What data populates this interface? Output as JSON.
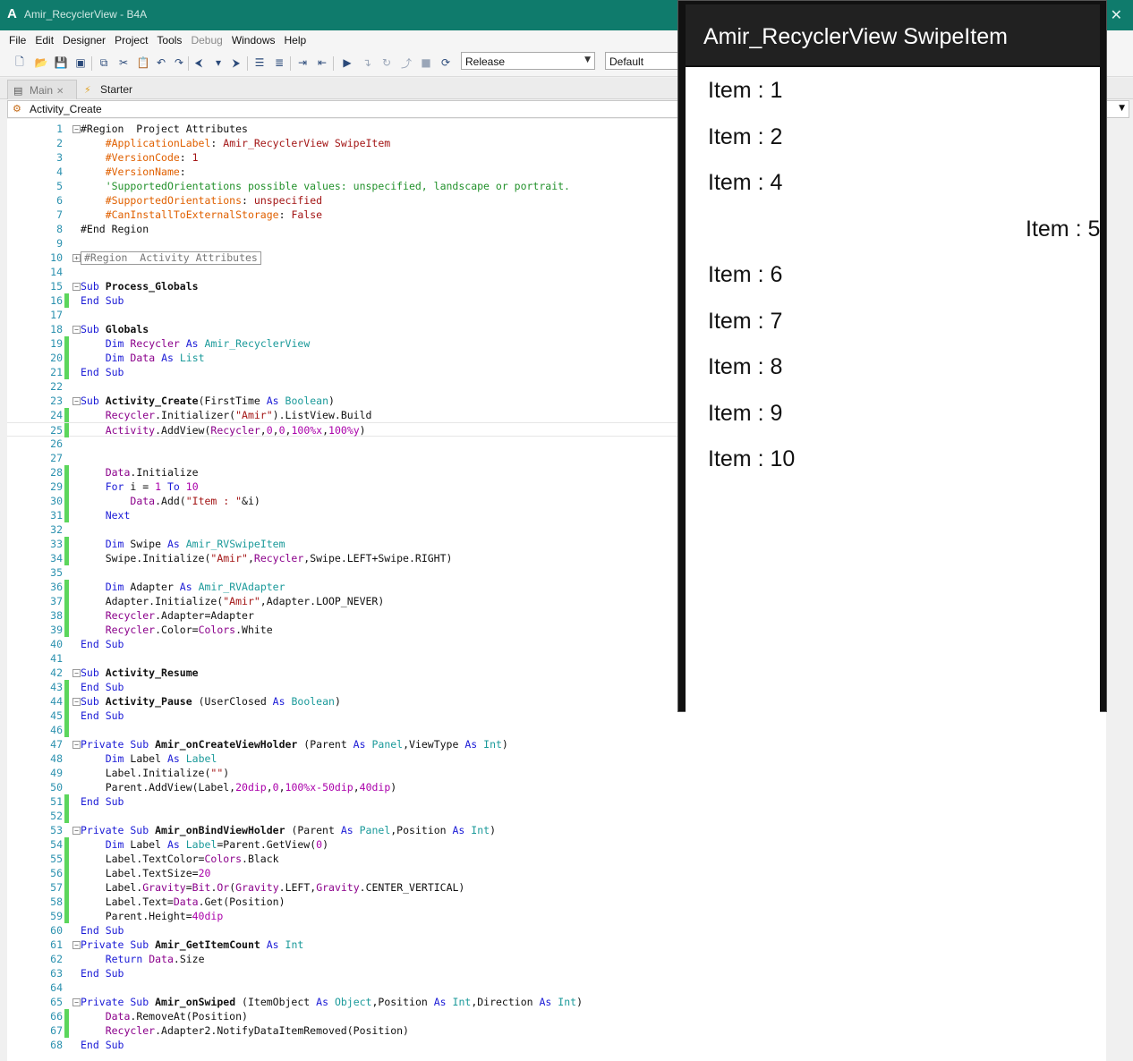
{
  "window": {
    "app_icon": "A",
    "title": "Amir_RecyclerView - B4A",
    "close_icon": "✕"
  },
  "menu": [
    "File",
    "Edit",
    "Designer",
    "Project",
    "Tools",
    "Debug",
    "Windows",
    "Help"
  ],
  "toolbar": {
    "build_config": "Release",
    "device_config": "Default"
  },
  "tabs": [
    {
      "label": "Main",
      "icon": "form-icon"
    },
    {
      "label": "Starter",
      "icon": "lightning-icon"
    }
  ],
  "sub_selector": "Activity_Create",
  "code": {
    "current_line": 25,
    "lines": [
      {
        "n": "1",
        "fold": "−",
        "mark": false,
        "html": "#Region  Project Attributes"
      },
      {
        "n": "2",
        "mark": false,
        "html": "    <span class='dr'>#ApplicationLabel</span>: <span class='st'>Amir_RecyclerView SwipeItem</span>"
      },
      {
        "n": "3",
        "mark": false,
        "html": "    <span class='dr'>#VersionCode</span>: <span class='st'>1</span>"
      },
      {
        "n": "4",
        "mark": false,
        "html": "    <span class='dr'>#VersionName</span>:"
      },
      {
        "n": "5",
        "mark": false,
        "html": "    <span class='cm'>'SupportedOrientations possible values: unspecified, landscape or portrait.</span>"
      },
      {
        "n": "6",
        "mark": false,
        "html": "    <span class='dr'>#SupportedOrientations</span>: <span class='st'>unspecified</span>"
      },
      {
        "n": "7",
        "mark": false,
        "html": "    <span class='dr'>#CanInstallToExternalStorage</span>: <span class='st'>False</span>"
      },
      {
        "n": "8",
        "mark": false,
        "html": "#End Region"
      },
      {
        "n": "9",
        "mark": false,
        "html": ""
      },
      {
        "n": "10",
        "fold": "+",
        "mark": false,
        "boxed": true,
        "html": "#Region  Activity Attributes"
      },
      {
        "n": "14",
        "mark": false,
        "html": ""
      },
      {
        "n": "15",
        "fold": "−",
        "mark": false,
        "html": "<span class='kw'>Sub</span> <span class='bd'>Process_Globals</span>"
      },
      {
        "n": "16",
        "mark": true,
        "html": "<span class='kw'>End Sub</span>"
      },
      {
        "n": "17",
        "mark": false,
        "html": ""
      },
      {
        "n": "18",
        "fold": "−",
        "mark": false,
        "html": "<span class='kw'>Sub</span> <span class='bd'>Globals</span>"
      },
      {
        "n": "19",
        "mark": true,
        "html": "    <span class='kw'>Dim</span> <span class='ob'>Recycler</span> <span class='kw'>As</span> <span class='ty'>Amir_RecyclerView</span>"
      },
      {
        "n": "20",
        "mark": true,
        "html": "    <span class='kw'>Dim</span> <span class='ob'>Data</span> <span class='kw'>As</span> <span class='ty'>List</span>"
      },
      {
        "n": "21",
        "mark": true,
        "html": "<span class='kw'>End Sub</span>"
      },
      {
        "n": "22",
        "mark": false,
        "html": ""
      },
      {
        "n": "23",
        "fold": "−",
        "mark": false,
        "html": "<span class='kw'>Sub</span> <span class='bd'>Activity_Create</span>(FirstTime <span class='kw'>As</span> <span class='ty'>Boolean</span>)"
      },
      {
        "n": "24",
        "mark": true,
        "html": "    <span class='ob'>Recycler</span>.Initializer(<span class='st'>\"Amir\"</span>).ListView.Build"
      },
      {
        "n": "25",
        "mark": true,
        "html": "    <span class='ob'>Activity</span>.AddView(<span class='ob'>Recycler</span>,<span class='nu'>0</span>,<span class='nu'>0</span>,<span class='nu'>100%x</span>,<span class='nu'>100%y</span>)"
      },
      {
        "n": "26",
        "mark": false,
        "html": ""
      },
      {
        "n": "27",
        "mark": false,
        "html": ""
      },
      {
        "n": "28",
        "mark": true,
        "html": "    <span class='ob'>Data</span>.Initialize"
      },
      {
        "n": "29",
        "mark": true,
        "html": "    <span class='kw'>For</span> i = <span class='nu'>1</span> <span class='kw'>To</span> <span class='nu'>10</span>"
      },
      {
        "n": "30",
        "mark": true,
        "html": "        <span class='ob'>Data</span>.Add(<span class='st'>\"Item : \"</span>&amp;i)"
      },
      {
        "n": "31",
        "mark": true,
        "html": "    <span class='kw'>Next</span>"
      },
      {
        "n": "32",
        "mark": false,
        "html": ""
      },
      {
        "n": "33",
        "mark": true,
        "html": "    <span class='kw'>Dim</span> Swipe <span class='kw'>As</span> <span class='ty'>Amir_RVSwipeItem</span>"
      },
      {
        "n": "34",
        "mark": true,
        "html": "    Swipe.Initialize(<span class='st'>\"Amir\"</span>,<span class='ob'>Recycler</span>,Swipe.LEFT+Swipe.RIGHT)"
      },
      {
        "n": "35",
        "mark": false,
        "html": ""
      },
      {
        "n": "36",
        "mark": true,
        "html": "    <span class='kw'>Dim</span> Adapter <span class='kw'>As</span> <span class='ty'>Amir_RVAdapter</span>"
      },
      {
        "n": "37",
        "mark": true,
        "html": "    Adapter.Initialize(<span class='st'>\"Amir\"</span>,Adapter.LOOP_NEVER)"
      },
      {
        "n": "38",
        "mark": true,
        "html": "    <span class='ob'>Recycler</span>.Adapter=Adapter"
      },
      {
        "n": "39",
        "mark": true,
        "html": "    <span class='ob'>Recycler</span>.Color=<span class='ob'>Colors</span>.White"
      },
      {
        "n": "40",
        "mark": false,
        "html": "<span class='kw'>End Sub</span>"
      },
      {
        "n": "41",
        "mark": false,
        "html": ""
      },
      {
        "n": "42",
        "fold": "−",
        "mark": false,
        "html": "<span class='kw'>Sub</span> <span class='bd'>Activity_Resume</span>"
      },
      {
        "n": "43",
        "mark": true,
        "html": "<span class='kw'>End Sub</span>"
      },
      {
        "n": "44",
        "fold": "−",
        "mark": true,
        "html": "<span class='kw'>Sub</span> <span class='bd'>Activity_Pause</span> (UserClosed <span class='kw'>As</span> <span class='ty'>Boolean</span>)"
      },
      {
        "n": "45",
        "mark": true,
        "html": "<span class='kw'>End Sub</span>"
      },
      {
        "n": "46",
        "mark": true,
        "html": ""
      },
      {
        "n": "47",
        "fold": "−",
        "mark": false,
        "html": "<span class='kw'>Private Sub</span> <span class='bd'>Amir_onCreateViewHolder</span> (Parent <span class='kw'>As</span> <span class='ty'>Panel</span>,ViewType <span class='kw'>As</span> <span class='ty'>Int</span>)"
      },
      {
        "n": "48",
        "mark": false,
        "html": "    <span class='kw'>Dim</span> Label <span class='kw'>As</span> <span class='ty'>Label</span>"
      },
      {
        "n": "49",
        "mark": false,
        "html": "    Label.Initialize(<span class='st'>\"\"</span>)"
      },
      {
        "n": "50",
        "mark": false,
        "html": "    Parent.AddView(Label,<span class='nu'>20dip</span>,<span class='nu'>0</span>,<span class='nu'>100%x-50dip</span>,<span class='nu'>40dip</span>)"
      },
      {
        "n": "51",
        "mark": true,
        "html": "<span class='kw'>End Sub</span>"
      },
      {
        "n": "52",
        "mark": true,
        "html": ""
      },
      {
        "n": "53",
        "fold": "−",
        "mark": false,
        "html": "<span class='kw'>Private Sub</span> <span class='bd'>Amir_onBindViewHolder</span> (Parent <span class='kw'>As</span> <span class='ty'>Panel</span>,Position <span class='kw'>As</span> <span class='ty'>Int</span>)"
      },
      {
        "n": "54",
        "mark": true,
        "html": "    <span class='kw'>Dim</span> Label <span class='kw'>As</span> <span class='ty'>Label</span>=Parent.GetView(<span class='nu'>0</span>)"
      },
      {
        "n": "55",
        "mark": true,
        "html": "    Label.TextColor=<span class='ob'>Colors</span>.Black"
      },
      {
        "n": "56",
        "mark": true,
        "html": "    Label.TextSize=<span class='nu'>20</span>"
      },
      {
        "n": "57",
        "mark": true,
        "html": "    Label.<span class='ob'>Gravity</span>=<span class='ob'>Bit</span>.<span class='ob'>Or</span>(<span class='ob'>Gravity</span>.LEFT,<span class='ob'>Gravity</span>.CENTER_VERTICAL)"
      },
      {
        "n": "58",
        "mark": true,
        "html": "    Label.Text=<span class='ob'>Data</span>.Get(Position)"
      },
      {
        "n": "59",
        "mark": true,
        "html": "    Parent.Height=<span class='nu'>40dip</span>"
      },
      {
        "n": "60",
        "mark": false,
        "html": "<span class='kw'>End Sub</span>"
      },
      {
        "n": "61",
        "fold": "−",
        "mark": false,
        "html": "<span class='kw'>Private Sub</span> <span class='bd'>Amir_GetItemCount</span> <span class='kw'>As</span> <span class='ty'>Int</span>"
      },
      {
        "n": "62",
        "mark": false,
        "html": "    <span class='kw'>Return</span> <span class='ob'>Data</span>.Size"
      },
      {
        "n": "63",
        "mark": false,
        "html": "<span class='kw'>End Sub</span>"
      },
      {
        "n": "64",
        "mark": false,
        "html": ""
      },
      {
        "n": "65",
        "fold": "−",
        "mark": false,
        "html": "<span class='kw'>Private Sub</span> <span class='bd'>Amir_onSwiped</span> (ItemObject <span class='kw'>As</span> <span class='ty'>Object</span>,Position <span class='kw'>As</span> <span class='ty'>Int</span>,Direction <span class='kw'>As</span> <span class='ty'>Int</span>)"
      },
      {
        "n": "66",
        "mark": true,
        "html": "    <span class='ob'>Data</span>.RemoveAt(Position)"
      },
      {
        "n": "67",
        "mark": true,
        "html": "    <span class='ob'>Recycler</span>.Adapter2.NotifyDataItemRemoved(Position)"
      },
      {
        "n": "68",
        "mark": false,
        "html": "<span class='kw'>End Sub</span>"
      }
    ]
  },
  "device": {
    "app_title": "Amir_RecyclerView SwipeItem",
    "items": [
      {
        "label": "Item : 1",
        "swiped": false
      },
      {
        "label": "Item : 2",
        "swiped": false
      },
      {
        "label": "Item : 4",
        "swiped": false
      },
      {
        "label": "Item : 5",
        "swiped": true
      },
      {
        "label": "Item : 6",
        "swiped": false
      },
      {
        "label": "Item : 7",
        "swiped": false
      },
      {
        "label": "Item : 8",
        "swiped": false
      },
      {
        "label": "Item : 9",
        "swiped": false
      },
      {
        "label": "Item : 10",
        "swiped": false
      }
    ]
  },
  "colors": {
    "titlebar": "#0f7b6c",
    "change_marker": "#5cd65c",
    "appbar": "#212121"
  }
}
